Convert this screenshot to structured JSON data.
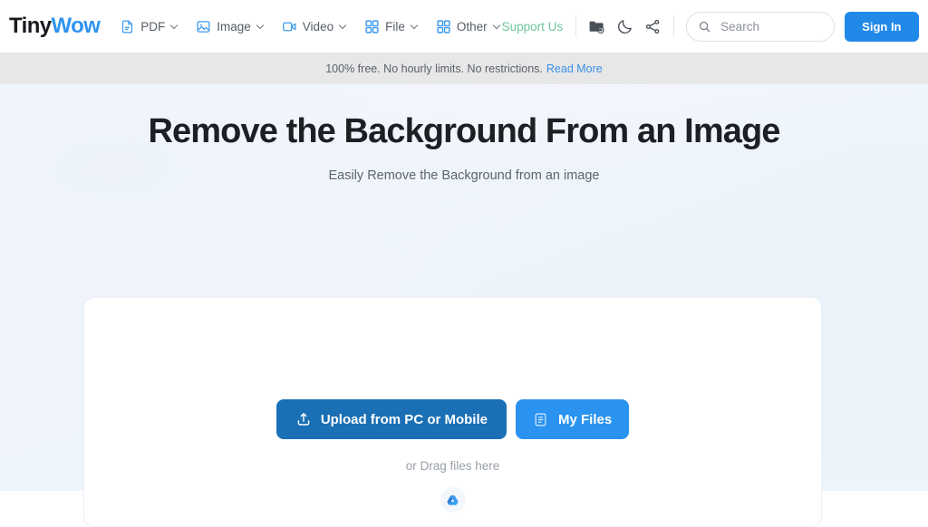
{
  "header": {
    "logo": {
      "part1": "Tiny",
      "part2": "Wow"
    },
    "nav": [
      {
        "label": "PDF",
        "icon": "pdf-file-icon"
      },
      {
        "label": "Image",
        "icon": "image-icon"
      },
      {
        "label": "Video",
        "icon": "video-camera-icon"
      },
      {
        "label": "File",
        "icon": "grid-icon"
      },
      {
        "label": "Other",
        "icon": "grid-icon"
      }
    ],
    "support_label": "Support Us",
    "icons": [
      {
        "name": "folder-cloud-icon"
      },
      {
        "name": "moon-icon"
      },
      {
        "name": "share-icon"
      }
    ],
    "search": {
      "placeholder": "Search",
      "value": ""
    },
    "signin_label": "Sign In"
  },
  "notice": {
    "text": "100% free. No hourly limits. No restrictions.",
    "link_label": "Read More"
  },
  "main": {
    "title": "Remove the Background From an Image",
    "subtitle": "Easily Remove the Background from an image",
    "upload_button_label": "Upload from PC or Mobile",
    "myfiles_button_label": "My Files",
    "drag_text": "or Drag files here",
    "drive_icon": "google-drive-icon"
  },
  "colors": {
    "brand_blue": "#2e94ef",
    "accent_blue": "#2189e8",
    "upload_blue": "#1a6fb5",
    "support_green": "#6ec49a",
    "notice_bg": "#e7e7e7",
    "link_blue": "#3b8ee8"
  }
}
